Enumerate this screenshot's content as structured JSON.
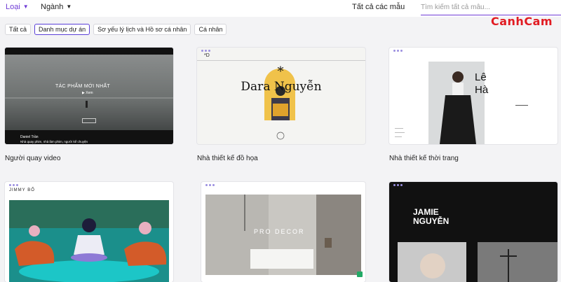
{
  "topbar": {
    "category_label": "Loại",
    "industry_label": "Ngành",
    "all_templates_label": "Tất cả các mẫu",
    "search_placeholder": "Tìm kiếm tất cả mẫu..."
  },
  "watermark": {
    "text_part1": "Canh",
    "text_part2": "Cam"
  },
  "chips": [
    {
      "label": "Tất cả"
    },
    {
      "label": "Danh mục dự án"
    },
    {
      "label": "Sơ yếu lý lịch và Hồ sơ cá nhân"
    },
    {
      "label": "Cá nhân"
    }
  ],
  "cards": [
    {
      "label": "Người quay video",
      "title": "TÁC PHẨM MỚI NHẤT",
      "button": "Xem",
      "name": "Daniel Trần",
      "subtitle": "Nhà quay phim, nhà làm phim, người kể chuyện"
    },
    {
      "label": "Nhà thiết kế đồ họa",
      "mark": "*D",
      "title": "Dara Nguyễn"
    },
    {
      "label": "Nhà thiết kế thời trang",
      "title_line1": "Lê",
      "title_line2": "Hà"
    },
    {
      "label": "",
      "brand": "JIMMY BỐ"
    },
    {
      "label": "",
      "title": "PRO DECOR"
    },
    {
      "label": "",
      "title_line1": "JAMIE",
      "title_line2": "NGUYỄN"
    }
  ],
  "colors": {
    "accent": "#6f3bd6",
    "brand_red": "#e11b22",
    "background": "#f3f3f5"
  }
}
